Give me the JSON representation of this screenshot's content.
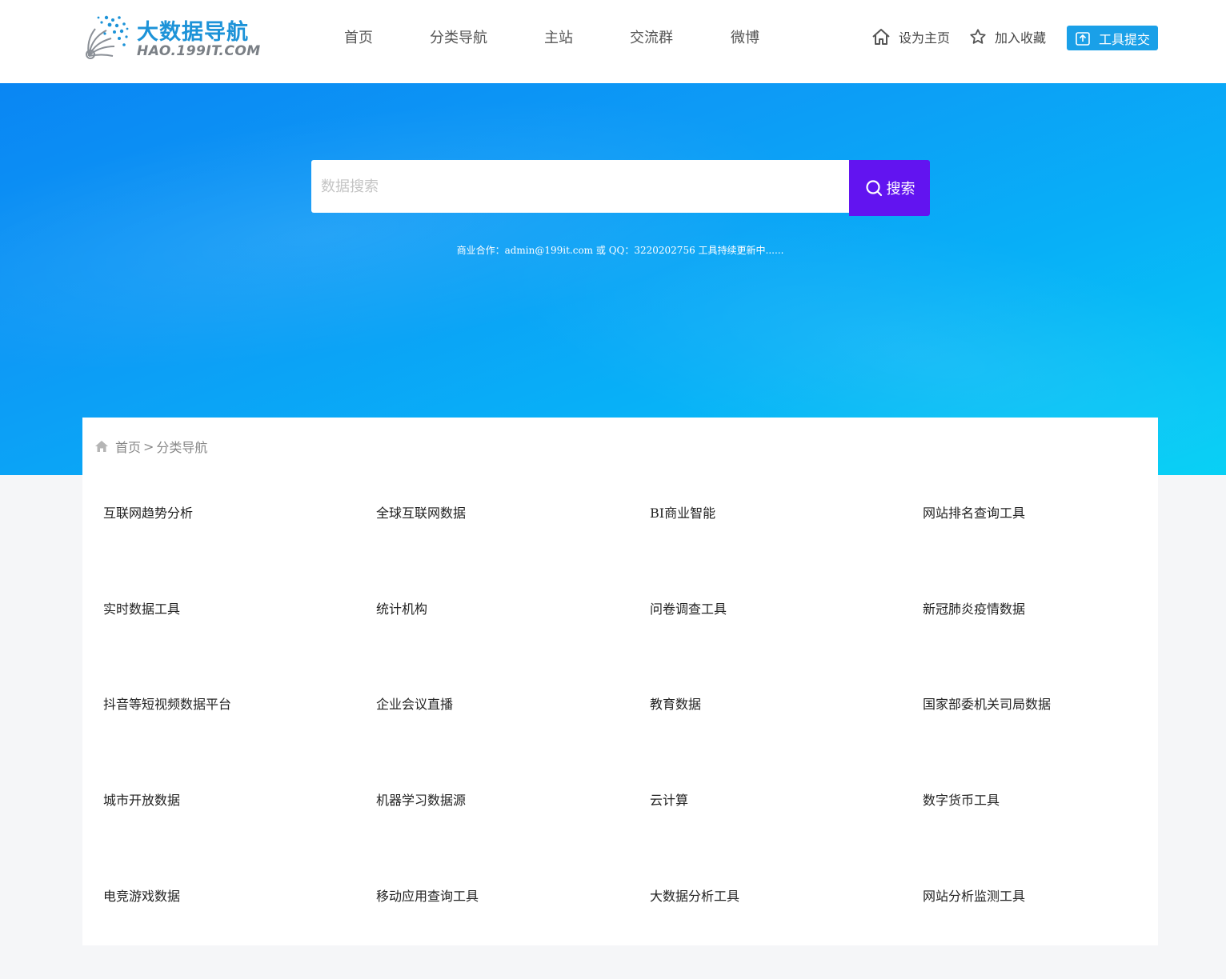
{
  "header": {
    "logo": {
      "title_cn": "大数据导航",
      "domain": "HAO.199IT.COM",
      "brand_color": "#1d93d8"
    },
    "nav": [
      {
        "label": "首页"
      },
      {
        "label": "分类导航"
      },
      {
        "label": "主站"
      },
      {
        "label": "交流群"
      },
      {
        "label": "微博"
      }
    ],
    "actions": {
      "set_home": {
        "label": "设为主页",
        "icon": "home-icon"
      },
      "add_favorite": {
        "label": "加入收藏",
        "icon": "star-icon"
      },
      "submit_tool": {
        "label": "工具提交",
        "icon": "upload-icon",
        "color": "#1aa0e8"
      }
    }
  },
  "hero": {
    "search": {
      "placeholder": "数据搜索",
      "value": "",
      "button_label": "搜索",
      "button_color": "#6214f0"
    },
    "note": "商业合作：admin@199it.com 或 QQ：3220202756 工具持续更新中......"
  },
  "breadcrumb": {
    "home": "首页",
    "separator": ">",
    "current": "分类导航"
  },
  "categories": [
    "互联网趋势分析",
    "全球互联网数据",
    "BI商业智能",
    "网站排名查询工具",
    "实时数据工具",
    "统计机构",
    "问卷调查工具",
    "新冠肺炎疫情数据",
    "抖音等短视频数据平台",
    "企业会议直播",
    "教育数据",
    "国家部委机关司局数据",
    "城市开放数据",
    "机器学习数据源",
    "云计算",
    "数字货币工具",
    "电竞游戏数据",
    "移动应用查询工具",
    "大数据分析工具",
    "网站分析监测工具"
  ]
}
